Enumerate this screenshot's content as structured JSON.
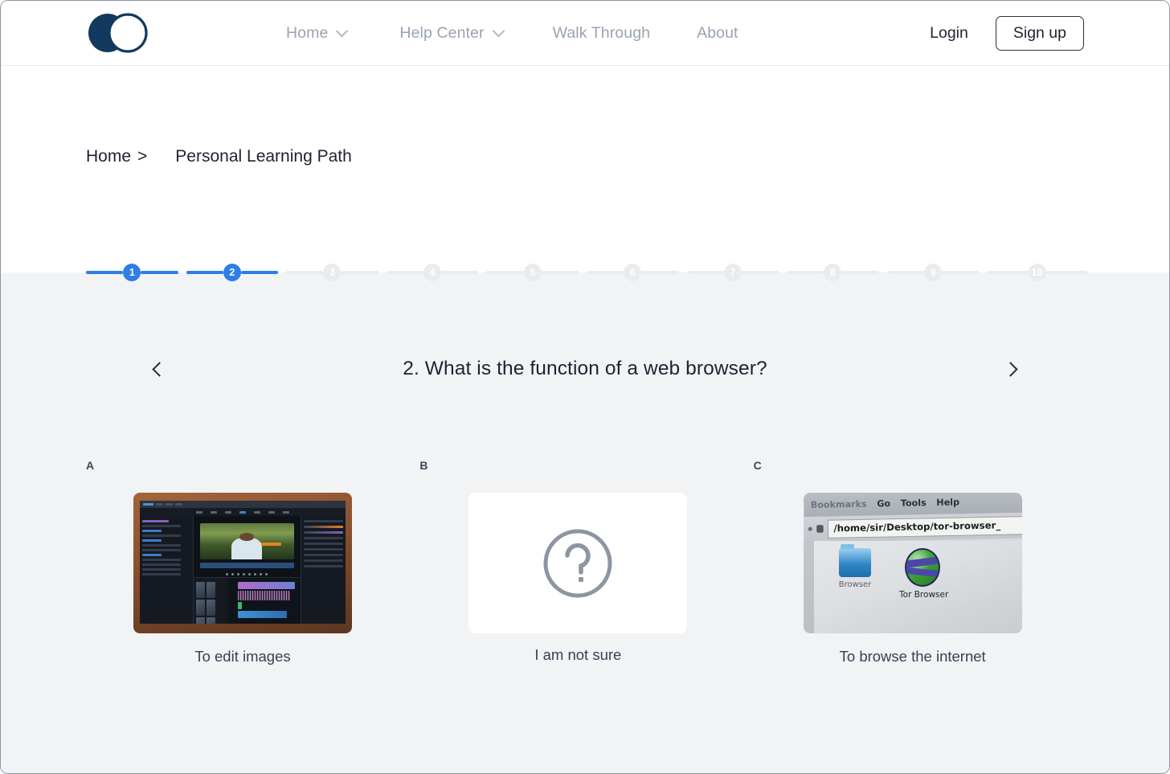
{
  "header": {
    "logo_name": "brand-logo",
    "nav": [
      {
        "label": "Home",
        "has_chevron": true
      },
      {
        "label": "Help Center",
        "has_chevron": true
      },
      {
        "label": "Walk Through",
        "has_chevron": false
      },
      {
        "label": "About",
        "has_chevron": false
      }
    ],
    "login_label": "Login",
    "signup_label": "Sign up"
  },
  "breadcrumb": {
    "home_label": "Home",
    "separator": ">",
    "current_label": "Personal Learning Path"
  },
  "stepper": {
    "steps": [
      "1",
      "2",
      "3",
      "4",
      "5",
      "6",
      "7",
      "8",
      "9",
      "10"
    ],
    "current": 2,
    "active_color": "#2f7ee8",
    "inactive_color": "#e9ebef"
  },
  "question": {
    "prev_label": "‹",
    "next_label": "›",
    "title": "2. What is the function of a web browser?"
  },
  "options": [
    {
      "letter": "A",
      "caption": "To edit images",
      "media": "video-editing-software-on-laptop-photo"
    },
    {
      "letter": "B",
      "caption": "I am not sure",
      "media": "question-mark-circle-icon"
    },
    {
      "letter": "C",
      "caption": "To browse the internet",
      "media": "tor-browser-desktop-photo"
    }
  ],
  "option_c_photo": {
    "menu_items": [
      "Bookmarks",
      "Go",
      "Tools",
      "Help"
    ],
    "path_value": "/home/sir/Desktop/tor-browser_",
    "desktop_icons": [
      "Browser",
      "Tor Browser"
    ]
  },
  "colors": {
    "page_background": "#ffffff",
    "body_background": "#f2f3f5",
    "accent_blue": "#2f7ee8",
    "text_dark": "#1f2330",
    "text_muted": "#9aa3b2",
    "logo_navy": "#123a5e"
  }
}
